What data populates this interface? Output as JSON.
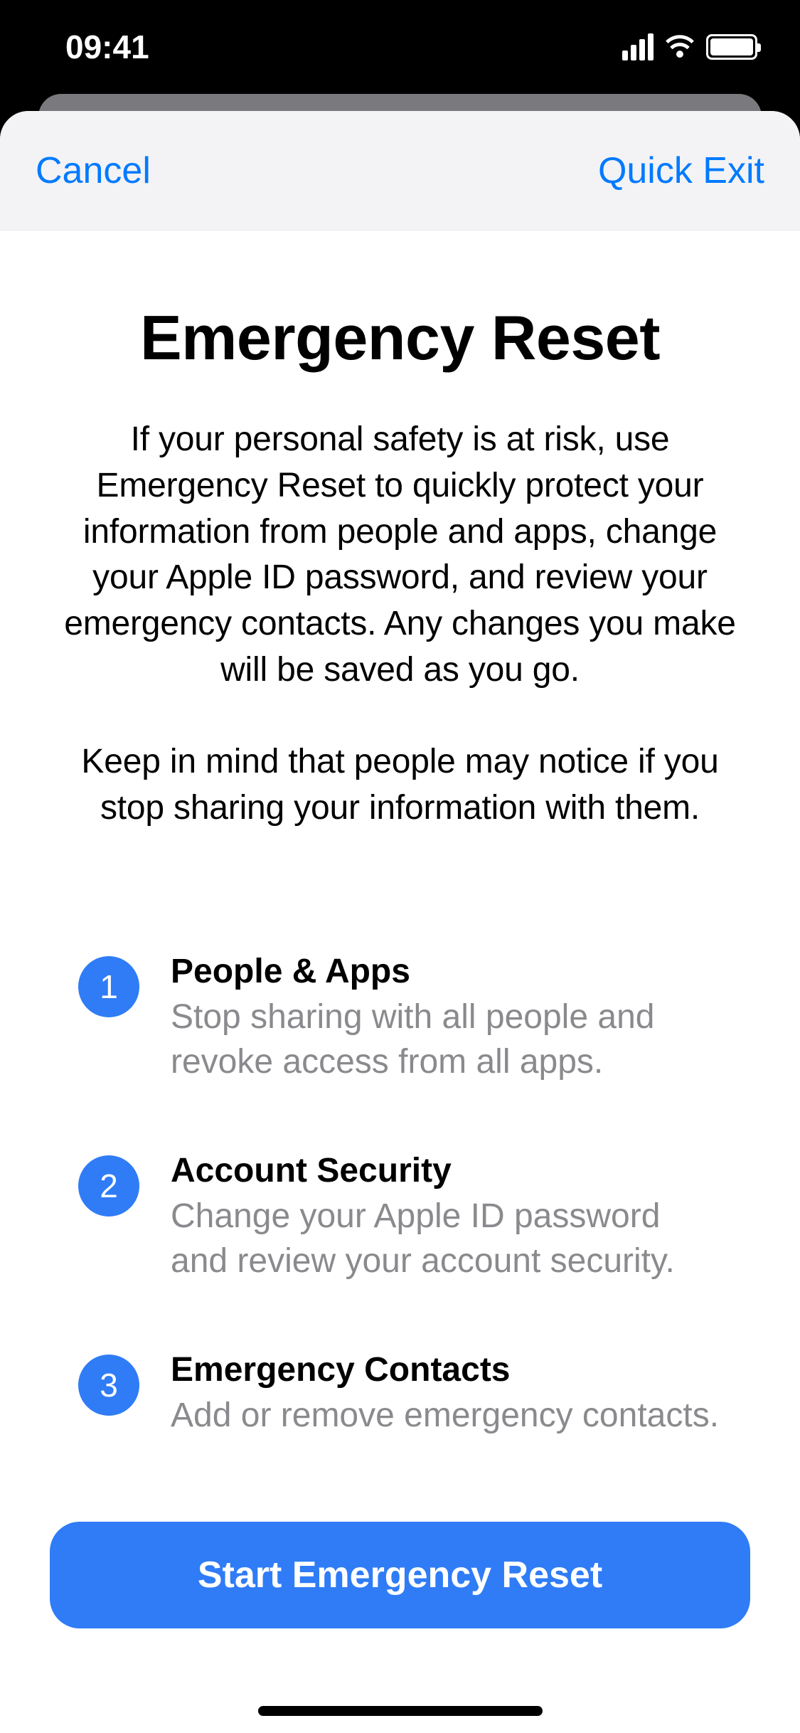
{
  "statusBar": {
    "time": "09:41"
  },
  "nav": {
    "cancel": "Cancel",
    "quickExit": "Quick Exit"
  },
  "page": {
    "title": "Emergency Reset",
    "description1": "If your personal safety is at risk, use Emergency Reset to quickly protect your information from people and apps, change your Apple ID password, and review your emergency contacts. Any changes you make will be saved as you go.",
    "description2": "Keep in mind that people may notice if you stop sharing your information with them."
  },
  "steps": [
    {
      "number": "1",
      "title": "People & Apps",
      "desc": "Stop sharing with all people and revoke access from all apps."
    },
    {
      "number": "2",
      "title": "Account Security",
      "desc": "Change your Apple ID password and review your account security."
    },
    {
      "number": "3",
      "title": "Emergency Contacts",
      "desc": "Add or remove emergency contacts."
    }
  ],
  "primaryButton": "Start Emergency Reset"
}
